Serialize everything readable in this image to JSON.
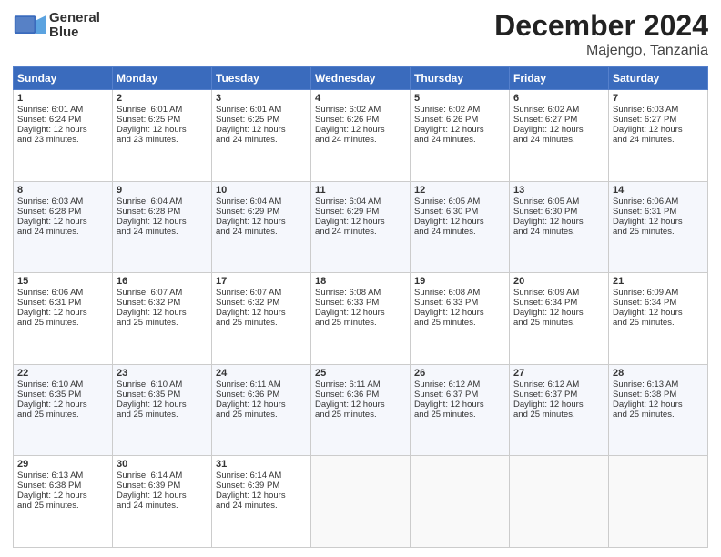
{
  "logo": {
    "line1": "General",
    "line2": "Blue"
  },
  "title": "December 2024",
  "location": "Majengo, Tanzania",
  "days_of_week": [
    "Sunday",
    "Monday",
    "Tuesday",
    "Wednesday",
    "Thursday",
    "Friday",
    "Saturday"
  ],
  "weeks": [
    [
      {
        "day": "1",
        "lines": [
          "Sunrise: 6:01 AM",
          "Sunset: 6:24 PM",
          "Daylight: 12 hours",
          "and 23 minutes."
        ]
      },
      {
        "day": "2",
        "lines": [
          "Sunrise: 6:01 AM",
          "Sunset: 6:25 PM",
          "Daylight: 12 hours",
          "and 23 minutes."
        ]
      },
      {
        "day": "3",
        "lines": [
          "Sunrise: 6:01 AM",
          "Sunset: 6:25 PM",
          "Daylight: 12 hours",
          "and 24 minutes."
        ]
      },
      {
        "day": "4",
        "lines": [
          "Sunrise: 6:02 AM",
          "Sunset: 6:26 PM",
          "Daylight: 12 hours",
          "and 24 minutes."
        ]
      },
      {
        "day": "5",
        "lines": [
          "Sunrise: 6:02 AM",
          "Sunset: 6:26 PM",
          "Daylight: 12 hours",
          "and 24 minutes."
        ]
      },
      {
        "day": "6",
        "lines": [
          "Sunrise: 6:02 AM",
          "Sunset: 6:27 PM",
          "Daylight: 12 hours",
          "and 24 minutes."
        ]
      },
      {
        "day": "7",
        "lines": [
          "Sunrise: 6:03 AM",
          "Sunset: 6:27 PM",
          "Daylight: 12 hours",
          "and 24 minutes."
        ]
      }
    ],
    [
      {
        "day": "8",
        "lines": [
          "Sunrise: 6:03 AM",
          "Sunset: 6:28 PM",
          "Daylight: 12 hours",
          "and 24 minutes."
        ]
      },
      {
        "day": "9",
        "lines": [
          "Sunrise: 6:04 AM",
          "Sunset: 6:28 PM",
          "Daylight: 12 hours",
          "and 24 minutes."
        ]
      },
      {
        "day": "10",
        "lines": [
          "Sunrise: 6:04 AM",
          "Sunset: 6:29 PM",
          "Daylight: 12 hours",
          "and 24 minutes."
        ]
      },
      {
        "day": "11",
        "lines": [
          "Sunrise: 6:04 AM",
          "Sunset: 6:29 PM",
          "Daylight: 12 hours",
          "and 24 minutes."
        ]
      },
      {
        "day": "12",
        "lines": [
          "Sunrise: 6:05 AM",
          "Sunset: 6:30 PM",
          "Daylight: 12 hours",
          "and 24 minutes."
        ]
      },
      {
        "day": "13",
        "lines": [
          "Sunrise: 6:05 AM",
          "Sunset: 6:30 PM",
          "Daylight: 12 hours",
          "and 24 minutes."
        ]
      },
      {
        "day": "14",
        "lines": [
          "Sunrise: 6:06 AM",
          "Sunset: 6:31 PM",
          "Daylight: 12 hours",
          "and 25 minutes."
        ]
      }
    ],
    [
      {
        "day": "15",
        "lines": [
          "Sunrise: 6:06 AM",
          "Sunset: 6:31 PM",
          "Daylight: 12 hours",
          "and 25 minutes."
        ]
      },
      {
        "day": "16",
        "lines": [
          "Sunrise: 6:07 AM",
          "Sunset: 6:32 PM",
          "Daylight: 12 hours",
          "and 25 minutes."
        ]
      },
      {
        "day": "17",
        "lines": [
          "Sunrise: 6:07 AM",
          "Sunset: 6:32 PM",
          "Daylight: 12 hours",
          "and 25 minutes."
        ]
      },
      {
        "day": "18",
        "lines": [
          "Sunrise: 6:08 AM",
          "Sunset: 6:33 PM",
          "Daylight: 12 hours",
          "and 25 minutes."
        ]
      },
      {
        "day": "19",
        "lines": [
          "Sunrise: 6:08 AM",
          "Sunset: 6:33 PM",
          "Daylight: 12 hours",
          "and 25 minutes."
        ]
      },
      {
        "day": "20",
        "lines": [
          "Sunrise: 6:09 AM",
          "Sunset: 6:34 PM",
          "Daylight: 12 hours",
          "and 25 minutes."
        ]
      },
      {
        "day": "21",
        "lines": [
          "Sunrise: 6:09 AM",
          "Sunset: 6:34 PM",
          "Daylight: 12 hours",
          "and 25 minutes."
        ]
      }
    ],
    [
      {
        "day": "22",
        "lines": [
          "Sunrise: 6:10 AM",
          "Sunset: 6:35 PM",
          "Daylight: 12 hours",
          "and 25 minutes."
        ]
      },
      {
        "day": "23",
        "lines": [
          "Sunrise: 6:10 AM",
          "Sunset: 6:35 PM",
          "Daylight: 12 hours",
          "and 25 minutes."
        ]
      },
      {
        "day": "24",
        "lines": [
          "Sunrise: 6:11 AM",
          "Sunset: 6:36 PM",
          "Daylight: 12 hours",
          "and 25 minutes."
        ]
      },
      {
        "day": "25",
        "lines": [
          "Sunrise: 6:11 AM",
          "Sunset: 6:36 PM",
          "Daylight: 12 hours",
          "and 25 minutes."
        ]
      },
      {
        "day": "26",
        "lines": [
          "Sunrise: 6:12 AM",
          "Sunset: 6:37 PM",
          "Daylight: 12 hours",
          "and 25 minutes."
        ]
      },
      {
        "day": "27",
        "lines": [
          "Sunrise: 6:12 AM",
          "Sunset: 6:37 PM",
          "Daylight: 12 hours",
          "and 25 minutes."
        ]
      },
      {
        "day": "28",
        "lines": [
          "Sunrise: 6:13 AM",
          "Sunset: 6:38 PM",
          "Daylight: 12 hours",
          "and 25 minutes."
        ]
      }
    ],
    [
      {
        "day": "29",
        "lines": [
          "Sunrise: 6:13 AM",
          "Sunset: 6:38 PM",
          "Daylight: 12 hours",
          "and 25 minutes."
        ]
      },
      {
        "day": "30",
        "lines": [
          "Sunrise: 6:14 AM",
          "Sunset: 6:39 PM",
          "Daylight: 12 hours",
          "and 24 minutes."
        ]
      },
      {
        "day": "31",
        "lines": [
          "Sunrise: 6:14 AM",
          "Sunset: 6:39 PM",
          "Daylight: 12 hours",
          "and 24 minutes."
        ]
      },
      null,
      null,
      null,
      null
    ]
  ]
}
